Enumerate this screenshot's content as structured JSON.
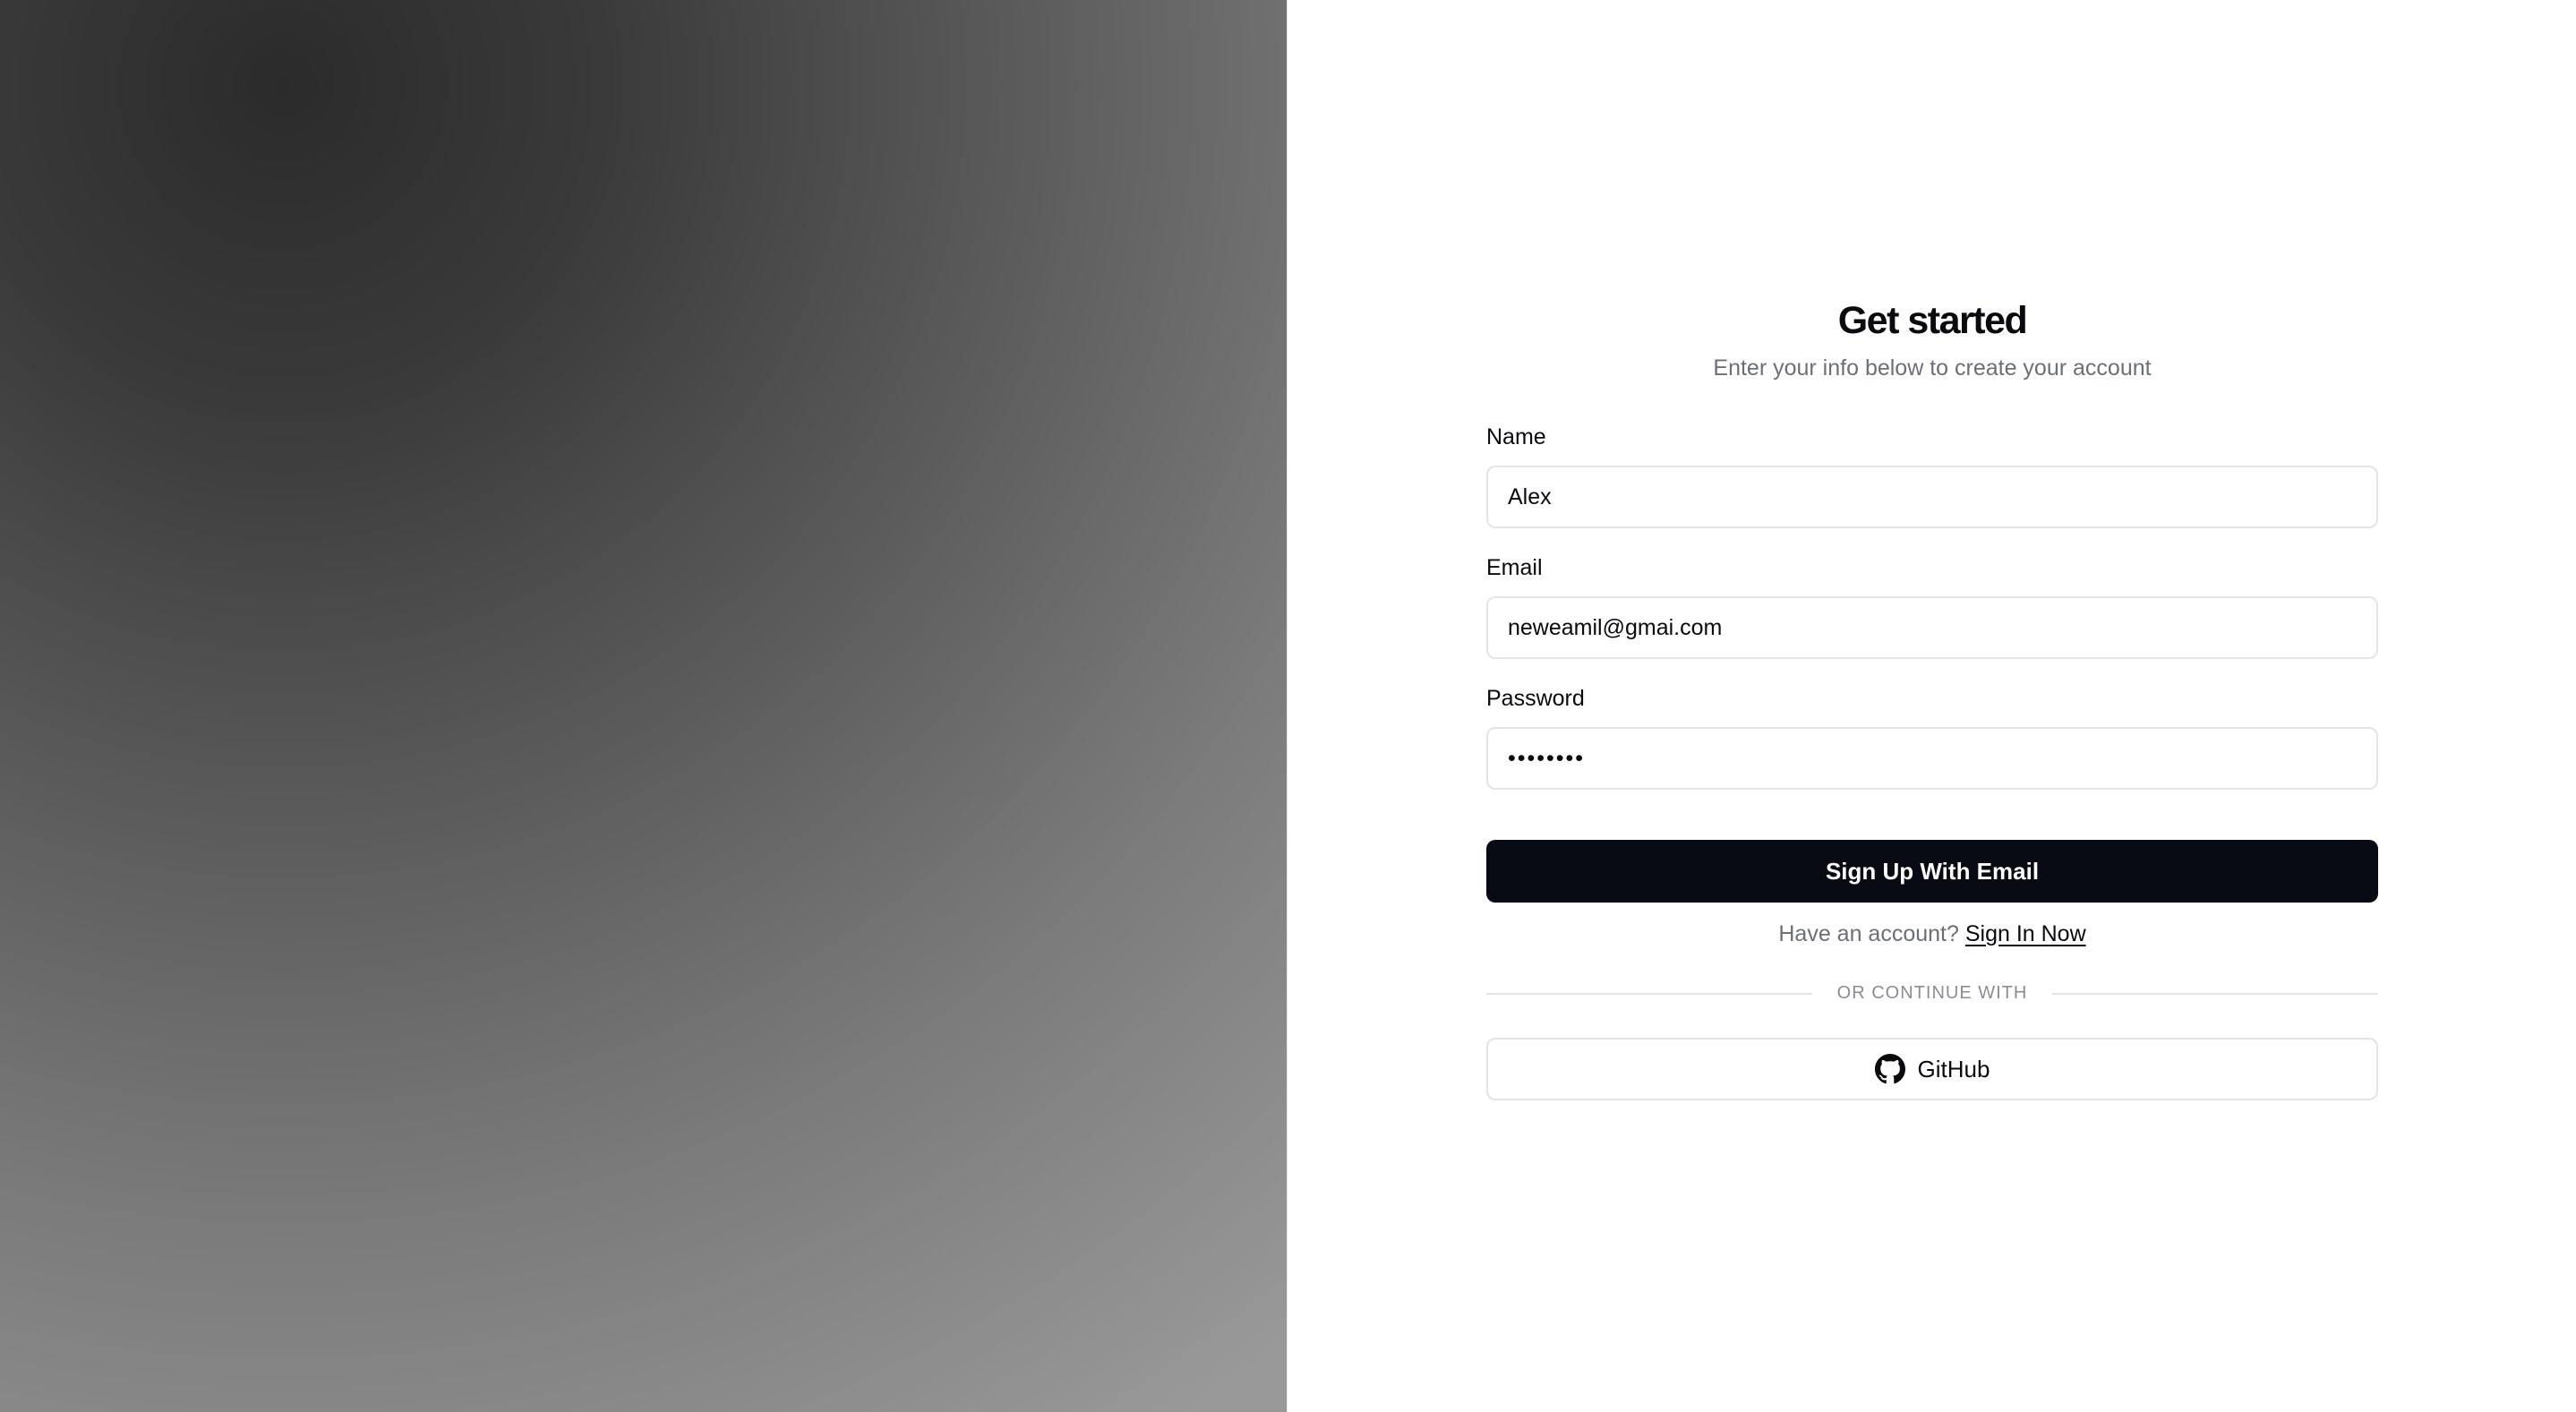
{
  "header": {
    "title": "Get started",
    "subtitle": "Enter your info below to create your account"
  },
  "form": {
    "name": {
      "label": "Name",
      "value": "Alex"
    },
    "email": {
      "label": "Email",
      "value": "neweamil@gmai.com"
    },
    "password": {
      "label": "Password",
      "value": "password"
    },
    "submit_label": "Sign Up With Email"
  },
  "signin": {
    "prompt": "Have an account?",
    "link_label": "Sign In Now"
  },
  "divider": {
    "text": "OR CONTINUE WITH"
  },
  "oauth": {
    "github_label": "GitHub",
    "github_icon": "github-icon"
  },
  "colors": {
    "primary_button": "#080b14",
    "border": "#e4e4e7",
    "muted_text": "#6b6f7a"
  }
}
